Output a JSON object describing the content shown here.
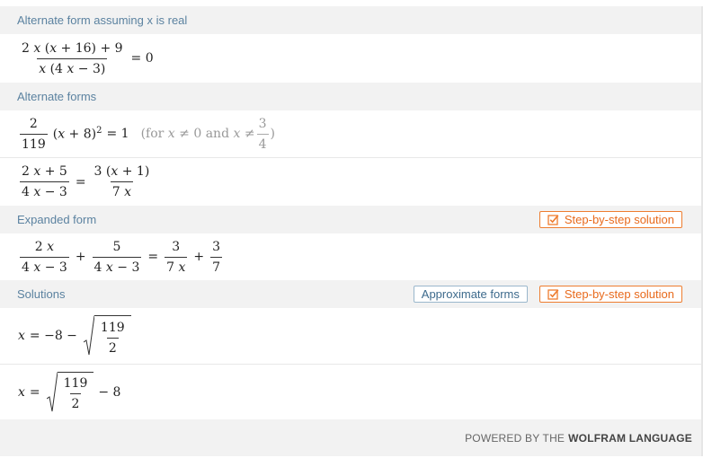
{
  "pods": {
    "alt_real": {
      "title": "Alternate form assuming x is real"
    },
    "alt_forms": {
      "title": "Alternate forms",
      "condition_text_prefix": "(for",
      "condition_and": "and"
    },
    "expanded": {
      "title": "Expanded form",
      "step_label": "Step-by-step solution"
    },
    "solutions": {
      "title": "Solutions",
      "approx_label": "Approximate forms",
      "step_label": "Step-by-step solution"
    }
  },
  "footer": {
    "powered_by": "POWERED BY THE",
    "brand": "WOLFRAM LANGUAGE"
  },
  "colors": {
    "accent_orange": "#ee7d30",
    "pod_title_blue": "#5b82a0",
    "approx_border": "#9ab7cc"
  }
}
